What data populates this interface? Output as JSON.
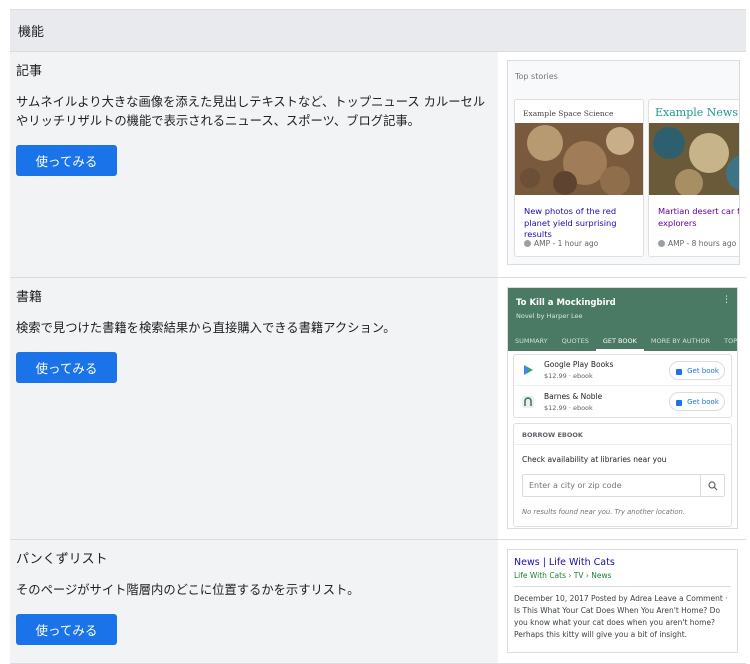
{
  "header": {
    "label": "機能"
  },
  "rows": [
    {
      "title": "記事",
      "desc": "サムネイルより大きな画像を添えた見出しテキストなど、トップニュース カルーセルやリッチリザルトの機能で表示されるニュース、スポーツ、ブログ記事。",
      "button": "使ってみる"
    },
    {
      "title": "書籍",
      "desc": "検索で見つけた書籍を検索結果から直接購入できる書籍アクション。",
      "button": "使ってみる"
    },
    {
      "title": "パンくずリスト",
      "desc": "そのページがサイト階層内のどこに位置するかを示すリスト。",
      "button": "使ってみる"
    }
  ],
  "top_stories": {
    "label": "Top stories",
    "cards": [
      {
        "publisher": "Example Space Science",
        "headline": "New photos of the red planet yield surprising results",
        "meta": "AMP - 1 hour ago",
        "headline_color": "#1a0dab"
      },
      {
        "publisher": "Example News",
        "headline": "Martian desert car food for explorers",
        "meta": "AMP - 8 hours ago",
        "headline_color": "#660099"
      }
    ]
  },
  "book": {
    "title": "To Kill a Mockingbird",
    "subtitle": "Novel by Harper Lee",
    "tabs": [
      "SUMMARY",
      "QUOTES",
      "GET BOOK",
      "MORE BY AUTHOR",
      "TOP"
    ],
    "active_tab": "GET BOOK",
    "sellers": [
      {
        "name": "Google Play Books",
        "price": "$12.99 · ebook",
        "button": "Get book",
        "icon": "play-icon"
      },
      {
        "name": "Barnes & Noble",
        "price": "$12.99 · ebook",
        "button": "Get book",
        "icon": "bn-icon"
      }
    ],
    "borrow_title": "BORROW EBOOK",
    "check_text": "Check availability at libraries near you",
    "input_placeholder": "Enter a city or zip code",
    "no_results": "No results found near you. Try another location."
  },
  "breadcrumb": {
    "title": "News | Life With Cats",
    "crumbs": "Life With Cats › TV › News",
    "text": "December 10, 2017 Posted by Adrea Leave a Comment · Is This What Your Cat Does When You Aren't Home? Do you know what your cat does when you aren't home? Perhaps this kitty will give you a bit of insight."
  },
  "colors": {
    "accent": "#1a73e8",
    "book_green": "#4a7a63"
  }
}
